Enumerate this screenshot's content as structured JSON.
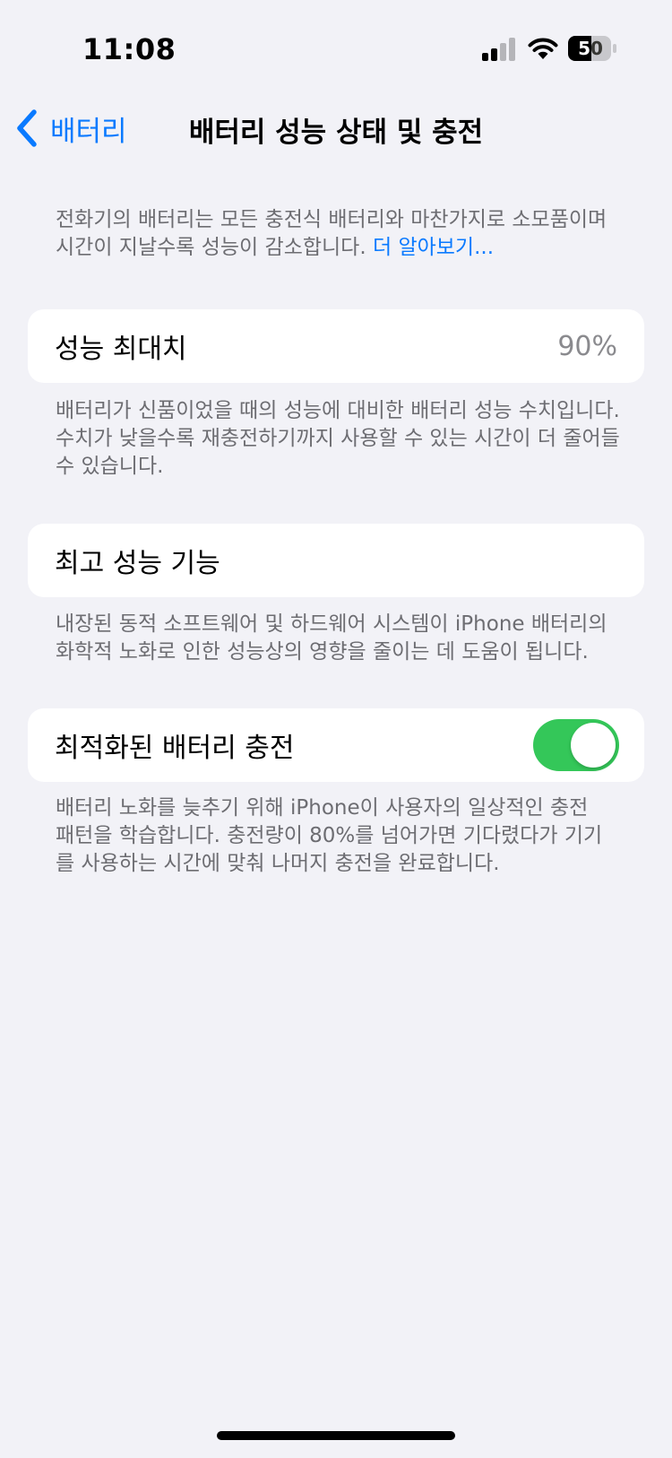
{
  "status_bar": {
    "time": "11:08",
    "battery_level": "50"
  },
  "nav": {
    "back_label": "배터리",
    "title": "배터리 성능 상태 및 충전"
  },
  "intro": {
    "text": "전화기의 배터리는 모든 충전식 배터리와 마찬가지로 소모품이며 시간이 지날수록 성능이 감소합니다.",
    "link": "더 알아보기..."
  },
  "max_capacity": {
    "label": "성능 최대치",
    "value": "90%",
    "footnote": "배터리가 신품이었을 때의 성능에 대비한 배터리 성능 수치입니다. 수치가 낮을수록 재충전하기까지 사용할 수 있는 시간이 더 줄어들 수 있습니다."
  },
  "peak_performance": {
    "label": "최고 성능 기능",
    "footnote": "내장된 동적 소프트웨어 및 하드웨어 시스템이 iPhone 배터리의 화학적 노화로 인한 성능상의 영향을 줄이는 데 도움이 됩니다."
  },
  "optimized_charging": {
    "label": "최적화된 배터리 충전",
    "enabled": true,
    "footnote": "배터리 노화를 늦추기 위해 iPhone이 사용자의 일상적인 충전 패턴을 학습합니다. 충전량이 80%를 넘어가면 기다렸다가 기기를 사용하는 시간에 맞춰 나머지 충전을 완료합니다."
  },
  "colors": {
    "accent": "#0a7aff",
    "toggle_on": "#34c759",
    "background": "#f2f2f7",
    "secondary_text": "#6d6d72"
  }
}
